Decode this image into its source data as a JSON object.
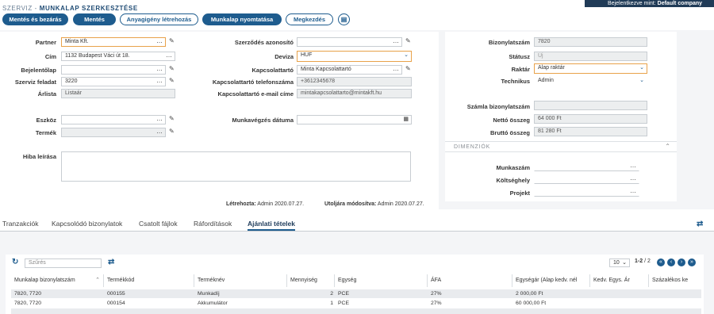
{
  "header": {
    "user_label": "Bejelentkezve mint:",
    "user_name": "Default company",
    "crumb_module": "SZERVIZ",
    "crumb_sep": " - ",
    "crumb_page": "MUNKALAP SZERKESZTÉSE"
  },
  "toolbar": {
    "save_close": "Mentés és bezárás",
    "save": "Mentés",
    "material_request": "Anyagigény létrehozás",
    "print": "Munkalap nyomtatása",
    "start": "Megkezdés"
  },
  "form": {
    "partner_label": "Partner",
    "partner_value": "Minta Kft.",
    "address_label": "Cím",
    "address_value": "1132 Budapest Váci út 18.",
    "report_label": "Bejelentőlap",
    "report_value": "",
    "task_label": "Szerviz feladat",
    "task_value": "3220",
    "pricelist_label": "Árlista",
    "pricelist_value": "Listaár",
    "device_label": "Eszköz",
    "device_value": "",
    "product_label": "Termék",
    "product_value": "",
    "fault_label": "Hiba leírása",
    "fault_value": "",
    "contract_label": "Szerződés azonosító",
    "contract_value": "",
    "currency_label": "Deviza",
    "currency_value": "HUF",
    "contact_label": "Kapcsolattartó",
    "contact_value": "Minta Kapcsolattartó",
    "contact_phone_label": "Kapcsolattartó telefonszáma",
    "contact_phone_value": "+3612345678",
    "contact_email_label": "Kapcsolattartó e-mail címe",
    "contact_email_value": "mintakapcsolattarto@mintakft.hu",
    "workdate_label": "Munkavégzés dátuma",
    "workdate_value": "",
    "created_label": "Létrehozta:",
    "created_value": "Admin 2020.07.27.",
    "modified_label": "Utoljára módosítva:",
    "modified_value": "Admin 2020.07.27."
  },
  "side": {
    "docno_label": "Bizonylatszám",
    "docno_value": "7820",
    "status_label": "Státusz",
    "status_value": "Új",
    "warehouse_label": "Raktár",
    "warehouse_value": "Alap raktár",
    "technician_label": "Technikus",
    "technician_value": "Admin",
    "invoice_label": "Számla bizonylatszám",
    "invoice_value": "",
    "net_label": "Nettó összeg",
    "net_value": "64 000 Ft",
    "gross_label": "Bruttó összeg",
    "gross_value": "81 280 Ft",
    "dim_title": "DIMENZIÓK",
    "jobno_label": "Munkaszám",
    "jobno_value": "",
    "costcenter_label": "Költséghely",
    "costcenter_value": "",
    "project_label": "Projekt",
    "project_value": ""
  },
  "tabs": [
    "Tranzakciók",
    "Kapcsolódó bizonylatok",
    "Csatolt fájlok",
    "Ráfordítások",
    "Ajánlati tételek"
  ],
  "grid": {
    "search_placeholder": "Szűrés",
    "page_size": "10",
    "page_range": "1-2",
    "page_total": "/ 2",
    "columns": [
      "Munkalap bizonylatszám",
      "Termékkód",
      "Terméknév",
      "Mennyiség",
      "Egység",
      "ÁFA",
      "Egységár (Alap kedv. nél",
      "Kedv. Egys. Ár",
      "Százalékos ke"
    ],
    "rows": [
      [
        "7820, 7720",
        "000155",
        "Munkadíj",
        "2",
        "PCE",
        "27%",
        "2 000,00 Ft",
        "",
        ""
      ],
      [
        "7820, 7720",
        "000154",
        "Akkumulátor",
        "1",
        "PCE",
        "27%",
        "60 000,00 Ft",
        "",
        ""
      ]
    ]
  },
  "colors": {
    "accent": "#1e5c8e",
    "topbar": "#203b57",
    "highlight": "#e8a24a"
  }
}
